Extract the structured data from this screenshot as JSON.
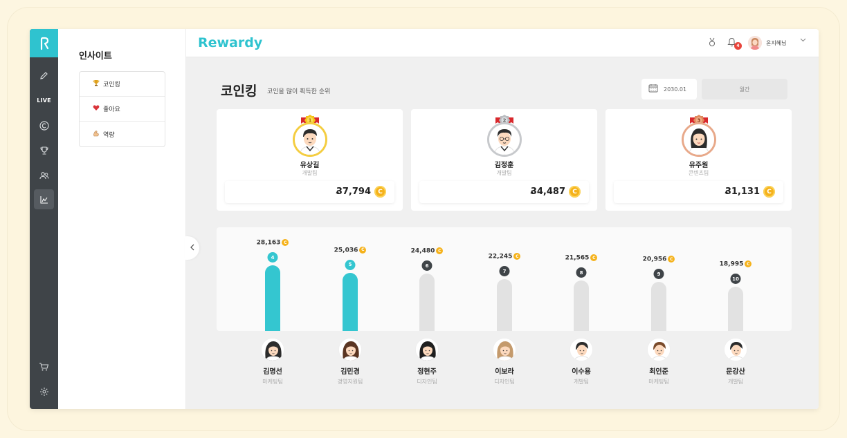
{
  "header": {
    "brand": "Rewardy",
    "notification_count": "4",
    "user_name": "윤지혜님"
  },
  "rail": {
    "live_label": "LIVE",
    "icons": [
      "logo-icon",
      "pencil-icon",
      "live-label",
      "coin-icon",
      "trophy-icon",
      "people-icon",
      "chart-icon",
      "cart-icon",
      "gear-icon"
    ]
  },
  "side": {
    "title": "인사이트",
    "items": [
      {
        "label": "코인킹",
        "icon": "trophy-emoji-icon"
      },
      {
        "label": "좋아요",
        "icon": "heart-emoji-icon"
      },
      {
        "label": "역량",
        "icon": "muscle-emoji-icon"
      }
    ]
  },
  "page": {
    "title": "코인킹",
    "subtitle": "코인을 많이 획득한 순위",
    "date": "2030.01",
    "period": "월간"
  },
  "colors": {
    "accent": "#34c6d0",
    "coin": "#f5b21b",
    "dark": "#3f4448",
    "gold": "#f4cd41",
    "silver": "#c7c9cc",
    "bronze": "#e8a98a"
  },
  "top3": [
    {
      "rank": "1",
      "name": "유상길",
      "team": "개발팀",
      "score": "37,794",
      "medal": "gold"
    },
    {
      "rank": "2",
      "name": "김정훈",
      "team": "개발팀",
      "score": "34,487",
      "medal": "silver"
    },
    {
      "rank": "3",
      "name": "유주원",
      "team": "콘텐츠팀",
      "score": "31,131",
      "medal": "bronze"
    }
  ],
  "ranking": [
    {
      "rank": "4",
      "name": "김명선",
      "team": "마케팅팀",
      "score": "28,163",
      "value": 28163,
      "highlight": true
    },
    {
      "rank": "5",
      "name": "김민경",
      "team": "경영지원팀",
      "score": "25,036",
      "value": 25036,
      "highlight": true
    },
    {
      "rank": "6",
      "name": "정현주",
      "team": "디자인팀",
      "score": "24,480",
      "value": 24480,
      "highlight": false
    },
    {
      "rank": "7",
      "name": "이보라",
      "team": "디자인팀",
      "score": "22,245",
      "value": 22245,
      "highlight": false
    },
    {
      "rank": "8",
      "name": "이수용",
      "team": "개발팀",
      "score": "21,565",
      "value": 21565,
      "highlight": false
    },
    {
      "rank": "9",
      "name": "최인준",
      "team": "마케팅팀",
      "score": "20,956",
      "value": 20956,
      "highlight": false
    },
    {
      "rank": "10",
      "name": "문강산",
      "team": "개발팀",
      "score": "18,995",
      "value": 18995,
      "highlight": false
    }
  ]
}
